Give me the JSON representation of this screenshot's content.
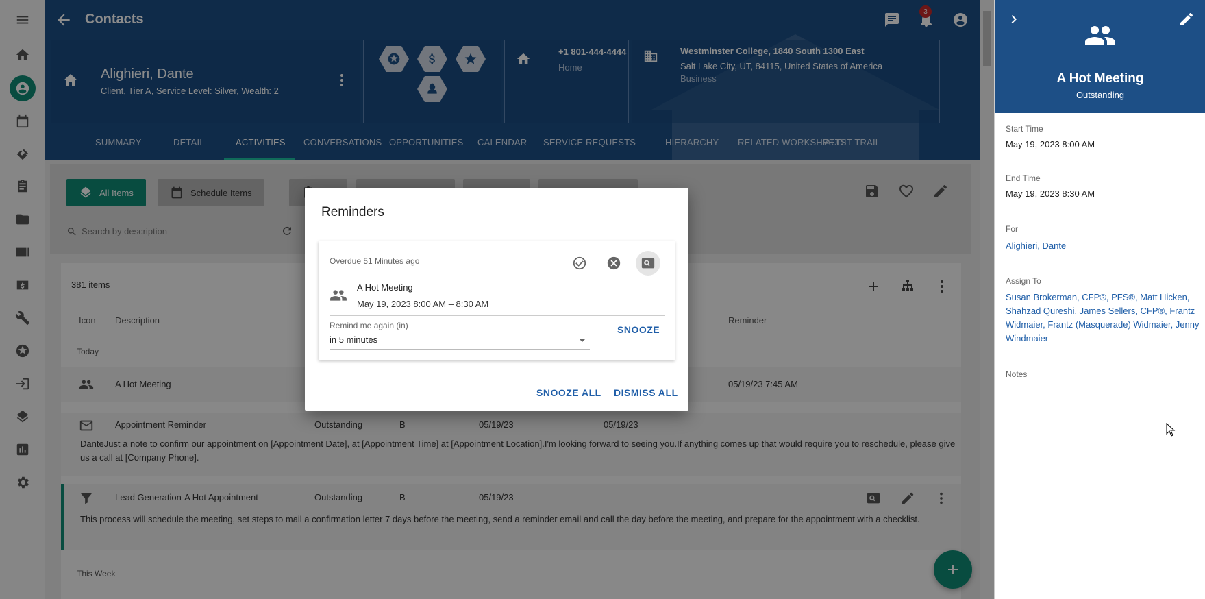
{
  "header": {
    "title": "Contacts",
    "notification_count": "3"
  },
  "contact": {
    "name": "Alighieri, Dante",
    "subtitle": "Client, Tier A, Service Level: Silver, Wealth: 2",
    "phone": "+1 801-444-4444",
    "phone_type": "Home",
    "address_line1": "Westminster College, 1840 South 1300 East",
    "address_line2": "Salt Lake City, UT, 84115, United States of America",
    "address_type": "Business"
  },
  "tabs": [
    {
      "label": "SUMMARY"
    },
    {
      "label": "DETAIL"
    },
    {
      "label": "ACTIVITIES"
    },
    {
      "label": "CONVERSATIONS"
    },
    {
      "label": "OPPORTUNITIES"
    },
    {
      "label": "CALENDAR"
    },
    {
      "label": "SERVICE REQUESTS"
    },
    {
      "label": "HIERARCHY"
    },
    {
      "label": "RELATED WORKSHEETS"
    },
    {
      "label": "AUDIT TRAIL"
    }
  ],
  "toolbar": {
    "all_items": "All Items",
    "schedule_items": "Schedule Items",
    "search_placeholder": "Search by description"
  },
  "list": {
    "count": "381 items",
    "columns": {
      "icon": "Icon",
      "description": "Description",
      "reminder": "Reminder"
    },
    "group_today": "Today",
    "group_week": "This Week",
    "rows": [
      {
        "description": "A Hot Meeting",
        "reminder": "05/19/23 7:45 AM"
      },
      {
        "description": "Appointment Reminder",
        "status": "Outstanding",
        "priority": "B",
        "start": "05/19/23",
        "due": "05/19/23",
        "body": "DanteJust a note to confirm our appointment on [Appointment Date], at [Appointment Time] at [Appointment Location].I'm looking forward to seeing you.If anything comes up that would require you to reschedule, please give us a call at [Company Phone]."
      },
      {
        "description": "Lead Generation-A Hot Appointment",
        "status": "Outstanding",
        "priority": "B",
        "start": "05/19/23",
        "body": "This process will schedule the meeting, set steps to mail a confirmation letter 7 days before the meeting, send a reminder email and call the day before the meeting, and prepare for the appointment with a checklist."
      }
    ]
  },
  "dialog": {
    "title": "Reminders",
    "overdue": "Overdue 51 Minutes ago",
    "event_name": "A Hot Meeting",
    "event_time": "May 19, 2023 8:00 AM – 8:30 AM",
    "remind_label": "Remind me again (in)",
    "remind_value": "in 5 minutes",
    "snooze": "SNOOZE",
    "snooze_all": "SNOOZE ALL",
    "dismiss_all": "DISMISS ALL"
  },
  "detail": {
    "title": "A Hot Meeting",
    "status": "Outstanding",
    "start_label": "Start Time",
    "start_value": "May 19, 2023 8:00 AM",
    "end_label": "End Time",
    "end_value": "May 19, 2023 8:30 AM",
    "for_label": "For",
    "for_value": "Alighieri, Dante",
    "assign_label": "Assign To",
    "assign_value": "Susan Brokerman, CFP®, PFS®, Matt Hicken, Shahzad Qureshi, James Sellers, CFP®, Frantz Widmaier, Frantz (Masquerade) Widmaier, Jenny Windmaier",
    "notes_label": "Notes"
  },
  "colors": {
    "brand_blue": "#1d4f86",
    "accent_teal": "#0f8a75",
    "link_blue": "#1f5ea8"
  }
}
